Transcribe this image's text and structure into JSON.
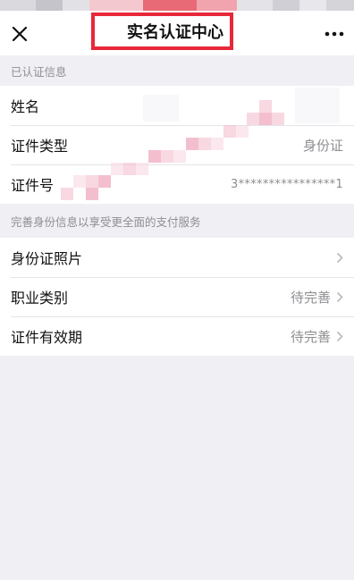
{
  "nav": {
    "title": "实名认证中心",
    "close_icon": "close-icon",
    "more_icon": "more-icon"
  },
  "verified_section": {
    "header": "已认证信息",
    "rows": [
      {
        "label": "姓名",
        "value": ""
      },
      {
        "label": "证件类型",
        "value": "身份证"
      },
      {
        "label": "证件号",
        "value": "3****************1"
      }
    ]
  },
  "improve_section": {
    "header": "完善身份信息以享受更全面的支付服务",
    "rows": [
      {
        "label": "身份证照片",
        "value": ""
      },
      {
        "label": "职业类别",
        "value": "待完善"
      },
      {
        "label": "证件有效期",
        "value": "待完善"
      }
    ]
  },
  "colors": {
    "highlight_border": "#e8283a",
    "background": "#efeff4",
    "secondary_text": "#8e8e93"
  }
}
